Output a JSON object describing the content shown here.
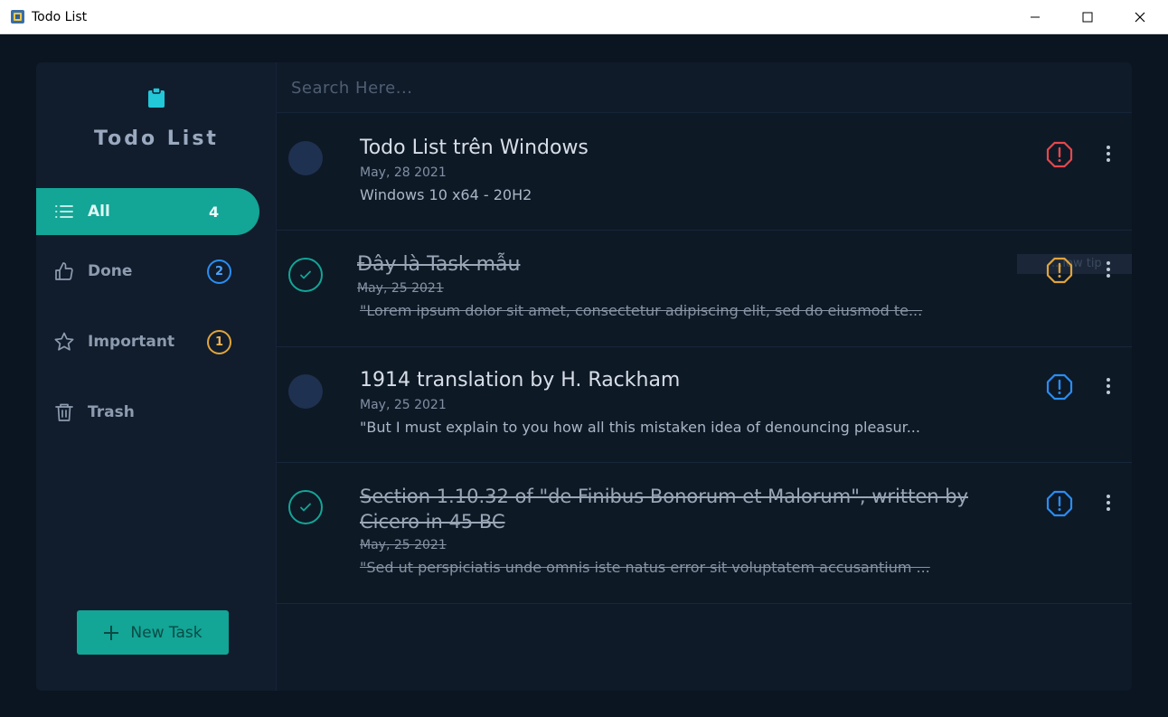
{
  "window": {
    "title": "Todo List",
    "minimize_icon": "minimize-icon",
    "maximize_icon": "maximize-icon",
    "close_icon": "close-icon"
  },
  "sidebar": {
    "brand_icon": "clipboard-icon",
    "brand_title": "Todo List",
    "items": [
      {
        "label": "All",
        "icon": "list-icon",
        "count": "4",
        "active": true
      },
      {
        "label": "Done",
        "icon": "thumbs-up-icon",
        "count": "2",
        "badge_color": "#2a8df2"
      },
      {
        "label": "Important",
        "icon": "star-icon",
        "count": "1",
        "badge_color": "#e0a43c"
      },
      {
        "label": "Trash",
        "icon": "trash-icon"
      }
    ],
    "new_task_label": "New Task"
  },
  "search": {
    "placeholder": "Search Here..."
  },
  "tasks": [
    {
      "title": "Todo List trên Windows",
      "date": "May, 28 2021",
      "description": "Windows 10 x64 - 20H2",
      "completed": false,
      "priority_color": "#e5484d"
    },
    {
      "title": "Đây là Task mẫu",
      "date": "May, 25 2021",
      "description": "\"Lorem ipsum dolor sit amet, consectetur adipiscing elit, sed do eiusmod te...",
      "completed": true,
      "priority_color": "#e0a43c"
    },
    {
      "title": "1914 translation by H. Rackham",
      "date": "May, 25 2021",
      "description": "\"But I must explain to you how all this mistaken idea of denouncing pleasur...",
      "completed": false,
      "priority_color": "#2a8df2"
    },
    {
      "title": "Section 1.10.32 of \"de Finibus Bonorum et Malorum\", written by Cicero in 45 BC",
      "date": "May, 25 2021",
      "description": "\"Sed ut perspiciatis unde omnis iste natus error sit voluptatem accusantium ...",
      "completed": true,
      "priority_color": "#2a8df2"
    }
  ],
  "tooltip": "...low tip"
}
